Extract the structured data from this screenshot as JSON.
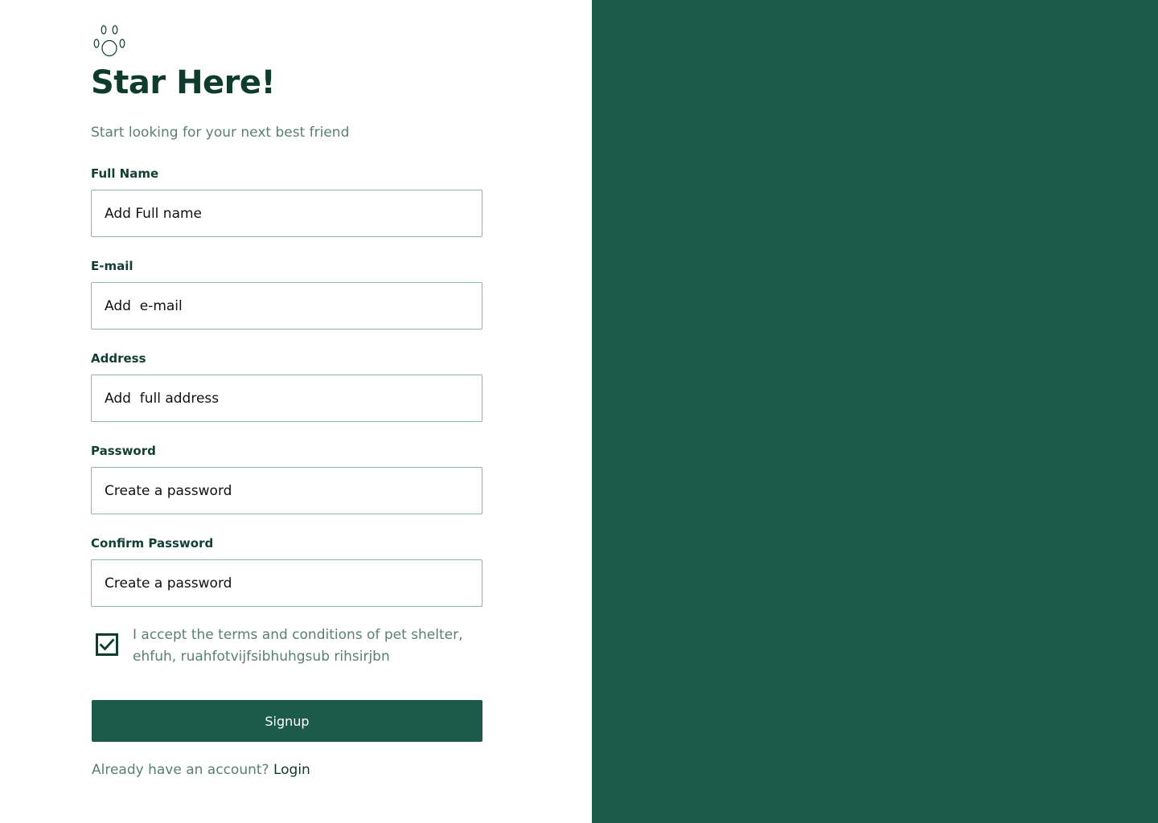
{
  "logo": {
    "icon": "paw-print-icon"
  },
  "heading": {
    "title": "Star Here!",
    "subtitle": "Start looking for your next best friend"
  },
  "form": {
    "fields": [
      {
        "label": "Full Name",
        "placeholder": "Add Full name",
        "value": ""
      },
      {
        "label": "E-mail",
        "placeholder": "Add  e-mail",
        "value": ""
      },
      {
        "label": "Address",
        "placeholder": "Add  full address",
        "value": ""
      },
      {
        "label": "Password",
        "placeholder": "Create a password",
        "value": ""
      },
      {
        "label": "Confirm Password",
        "placeholder": "Create a password",
        "value": ""
      }
    ],
    "terms": {
      "checked": true,
      "text": "I accept the terms and conditions of pet shelter, ehfuh, ruahfotvijfsibhuhgsub rihsirjbn"
    },
    "submit_label": "Signup"
  },
  "footer": {
    "prompt": "Already have an account?",
    "login_label": "Login"
  },
  "colors": {
    "brand_green": "#1c5a49",
    "heading_dark": "#0f3b2e",
    "muted_text": "#5a7f74",
    "input_border": "#8fb5aa"
  }
}
